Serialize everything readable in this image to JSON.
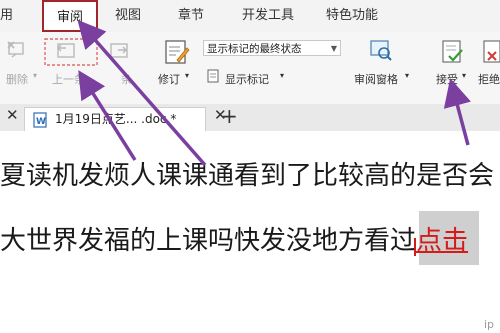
{
  "menubar": {
    "items": [
      {
        "label": "用"
      },
      {
        "label": "审阅"
      },
      {
        "label": "视图"
      },
      {
        "label": "章节"
      },
      {
        "label": "开发工具"
      },
      {
        "label": "特色功能"
      }
    ],
    "active_index": 1
  },
  "ribbon": {
    "delete_label": "删除",
    "prev_label": "上一条",
    "next_label": "条",
    "revise_label": "修订",
    "display_state_value": "显示标记的最终状态",
    "show_markup_label": "显示标记",
    "review_pane_label": "审阅窗格",
    "accept_label": "接受",
    "reject_label": "拒绝"
  },
  "docbar": {
    "tab_title": "1月19日点艺... .doc *",
    "new_tab_symbol": "+"
  },
  "document": {
    "line1": "夏读机发烦人课课通看到了比较高的是否会",
    "line2_plain": "大世界发福的上课吗快发没地方看过",
    "line2_tracked": "点击"
  },
  "colors": {
    "active_tab_border": "#a0262c",
    "arrow": "#7b3fa0",
    "tracked_change": "#d21b1b"
  },
  "watermark": "ip"
}
